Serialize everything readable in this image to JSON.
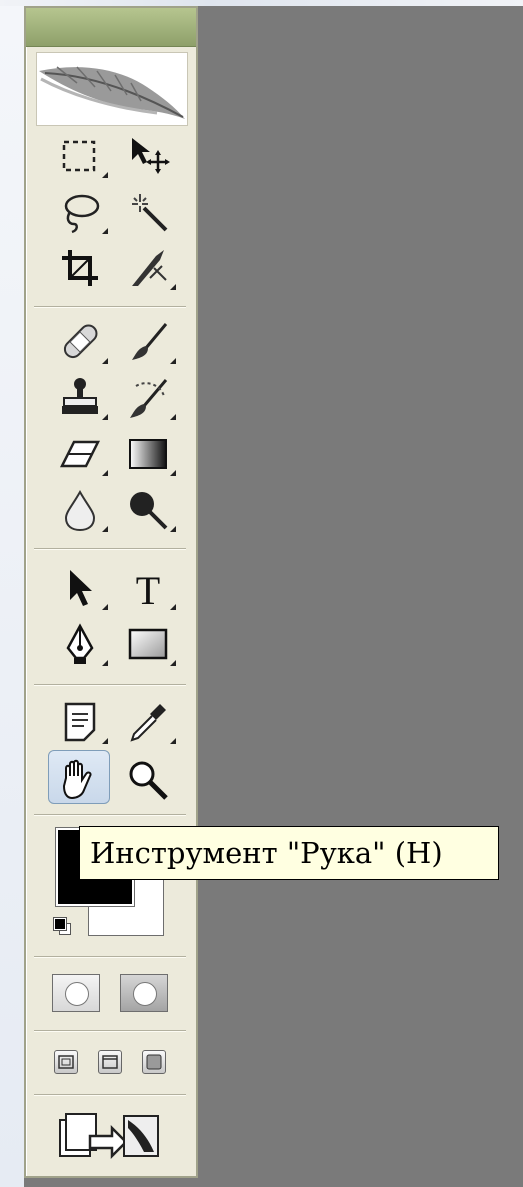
{
  "app": {
    "tooltip": "Инструмент \"Рука\" (H)"
  },
  "palette": {
    "workspace_color": "#7a7a7a",
    "panel_color": "#eceadb",
    "title_bar_color": "#9cae78",
    "selection_color": "#c9d8ea"
  },
  "tools": [
    {
      "name": "rectangular-marquee-icon"
    },
    {
      "name": "move-icon"
    },
    {
      "name": "lasso-icon"
    },
    {
      "name": "magic-wand-icon"
    },
    {
      "name": "crop-icon"
    },
    {
      "name": "slice-icon"
    },
    {
      "name": "healing-brush-icon"
    },
    {
      "name": "brush-icon"
    },
    {
      "name": "clone-stamp-icon"
    },
    {
      "name": "history-brush-icon"
    },
    {
      "name": "eraser-icon"
    },
    {
      "name": "gradient-icon"
    },
    {
      "name": "blur-icon"
    },
    {
      "name": "dodge-icon"
    },
    {
      "name": "path-selection-icon"
    },
    {
      "name": "type-icon",
      "glyph": "T"
    },
    {
      "name": "pen-icon"
    },
    {
      "name": "rectangle-shape-icon"
    },
    {
      "name": "notes-icon"
    },
    {
      "name": "eyedropper-icon"
    },
    {
      "name": "hand-icon",
      "selected": true
    },
    {
      "name": "zoom-icon"
    }
  ],
  "colors": {
    "foreground": "#000000",
    "background": "#ffffff"
  }
}
